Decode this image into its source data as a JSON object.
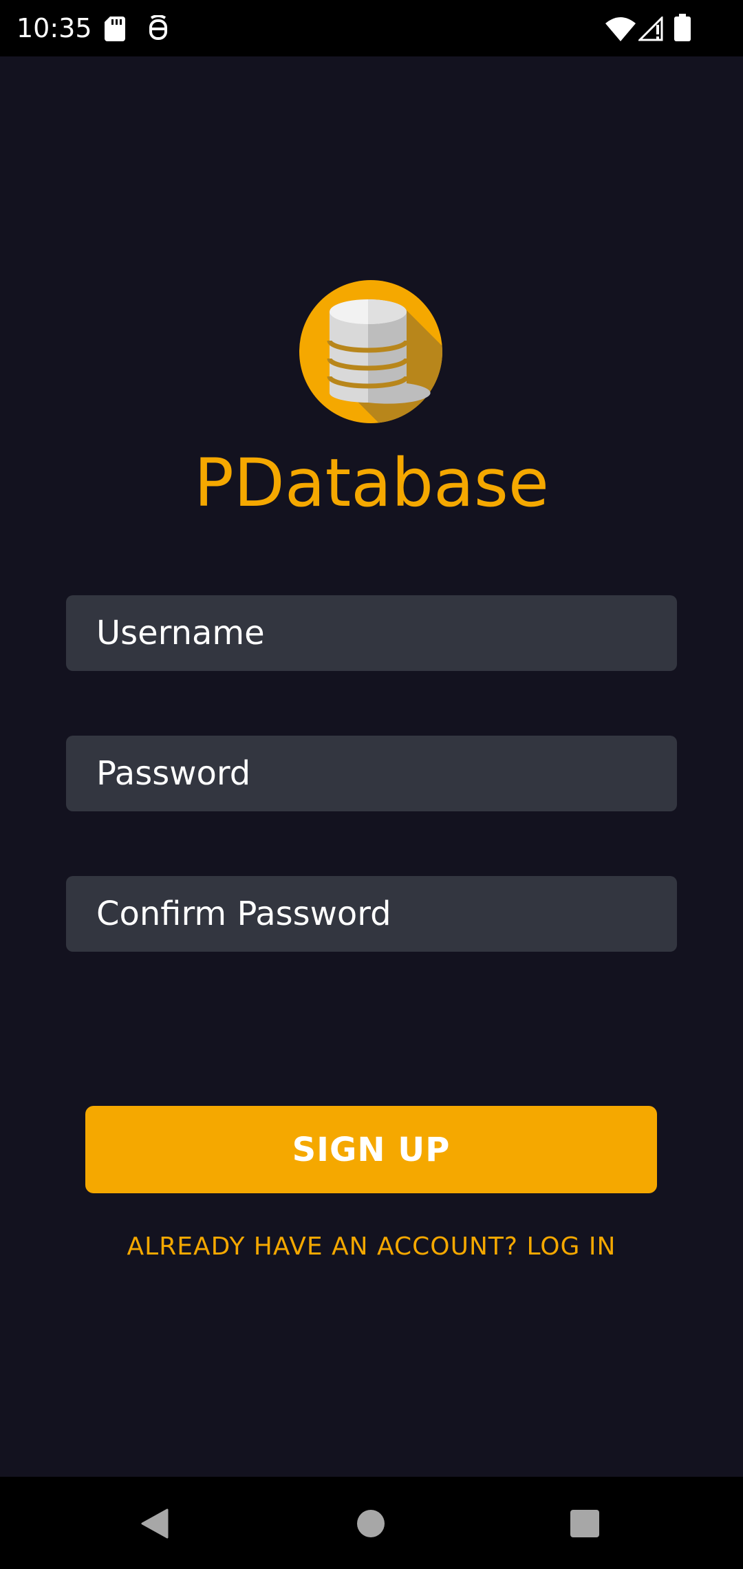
{
  "status_bar": {
    "time": "10:35",
    "icons": [
      "sd-card-icon",
      "notification-app-icon",
      "wifi-icon",
      "signal-icon",
      "battery-icon"
    ]
  },
  "app": {
    "title": "PDatabase",
    "logo_icon": "database-icon",
    "fields": {
      "username_placeholder": "Username",
      "password_placeholder": "Password",
      "confirm_password_placeholder": "Confirm Password"
    },
    "signup_label": "SIGN UP",
    "login_link": "ALREADY HAVE AN ACCOUNT? LOG IN"
  },
  "nav_bar": {
    "icons": [
      "back-icon",
      "home-icon",
      "recents-icon"
    ]
  },
  "colors": {
    "background": "#13121f",
    "accent": "#f5a800",
    "field_background": "#333640",
    "text": "#ffffff"
  }
}
